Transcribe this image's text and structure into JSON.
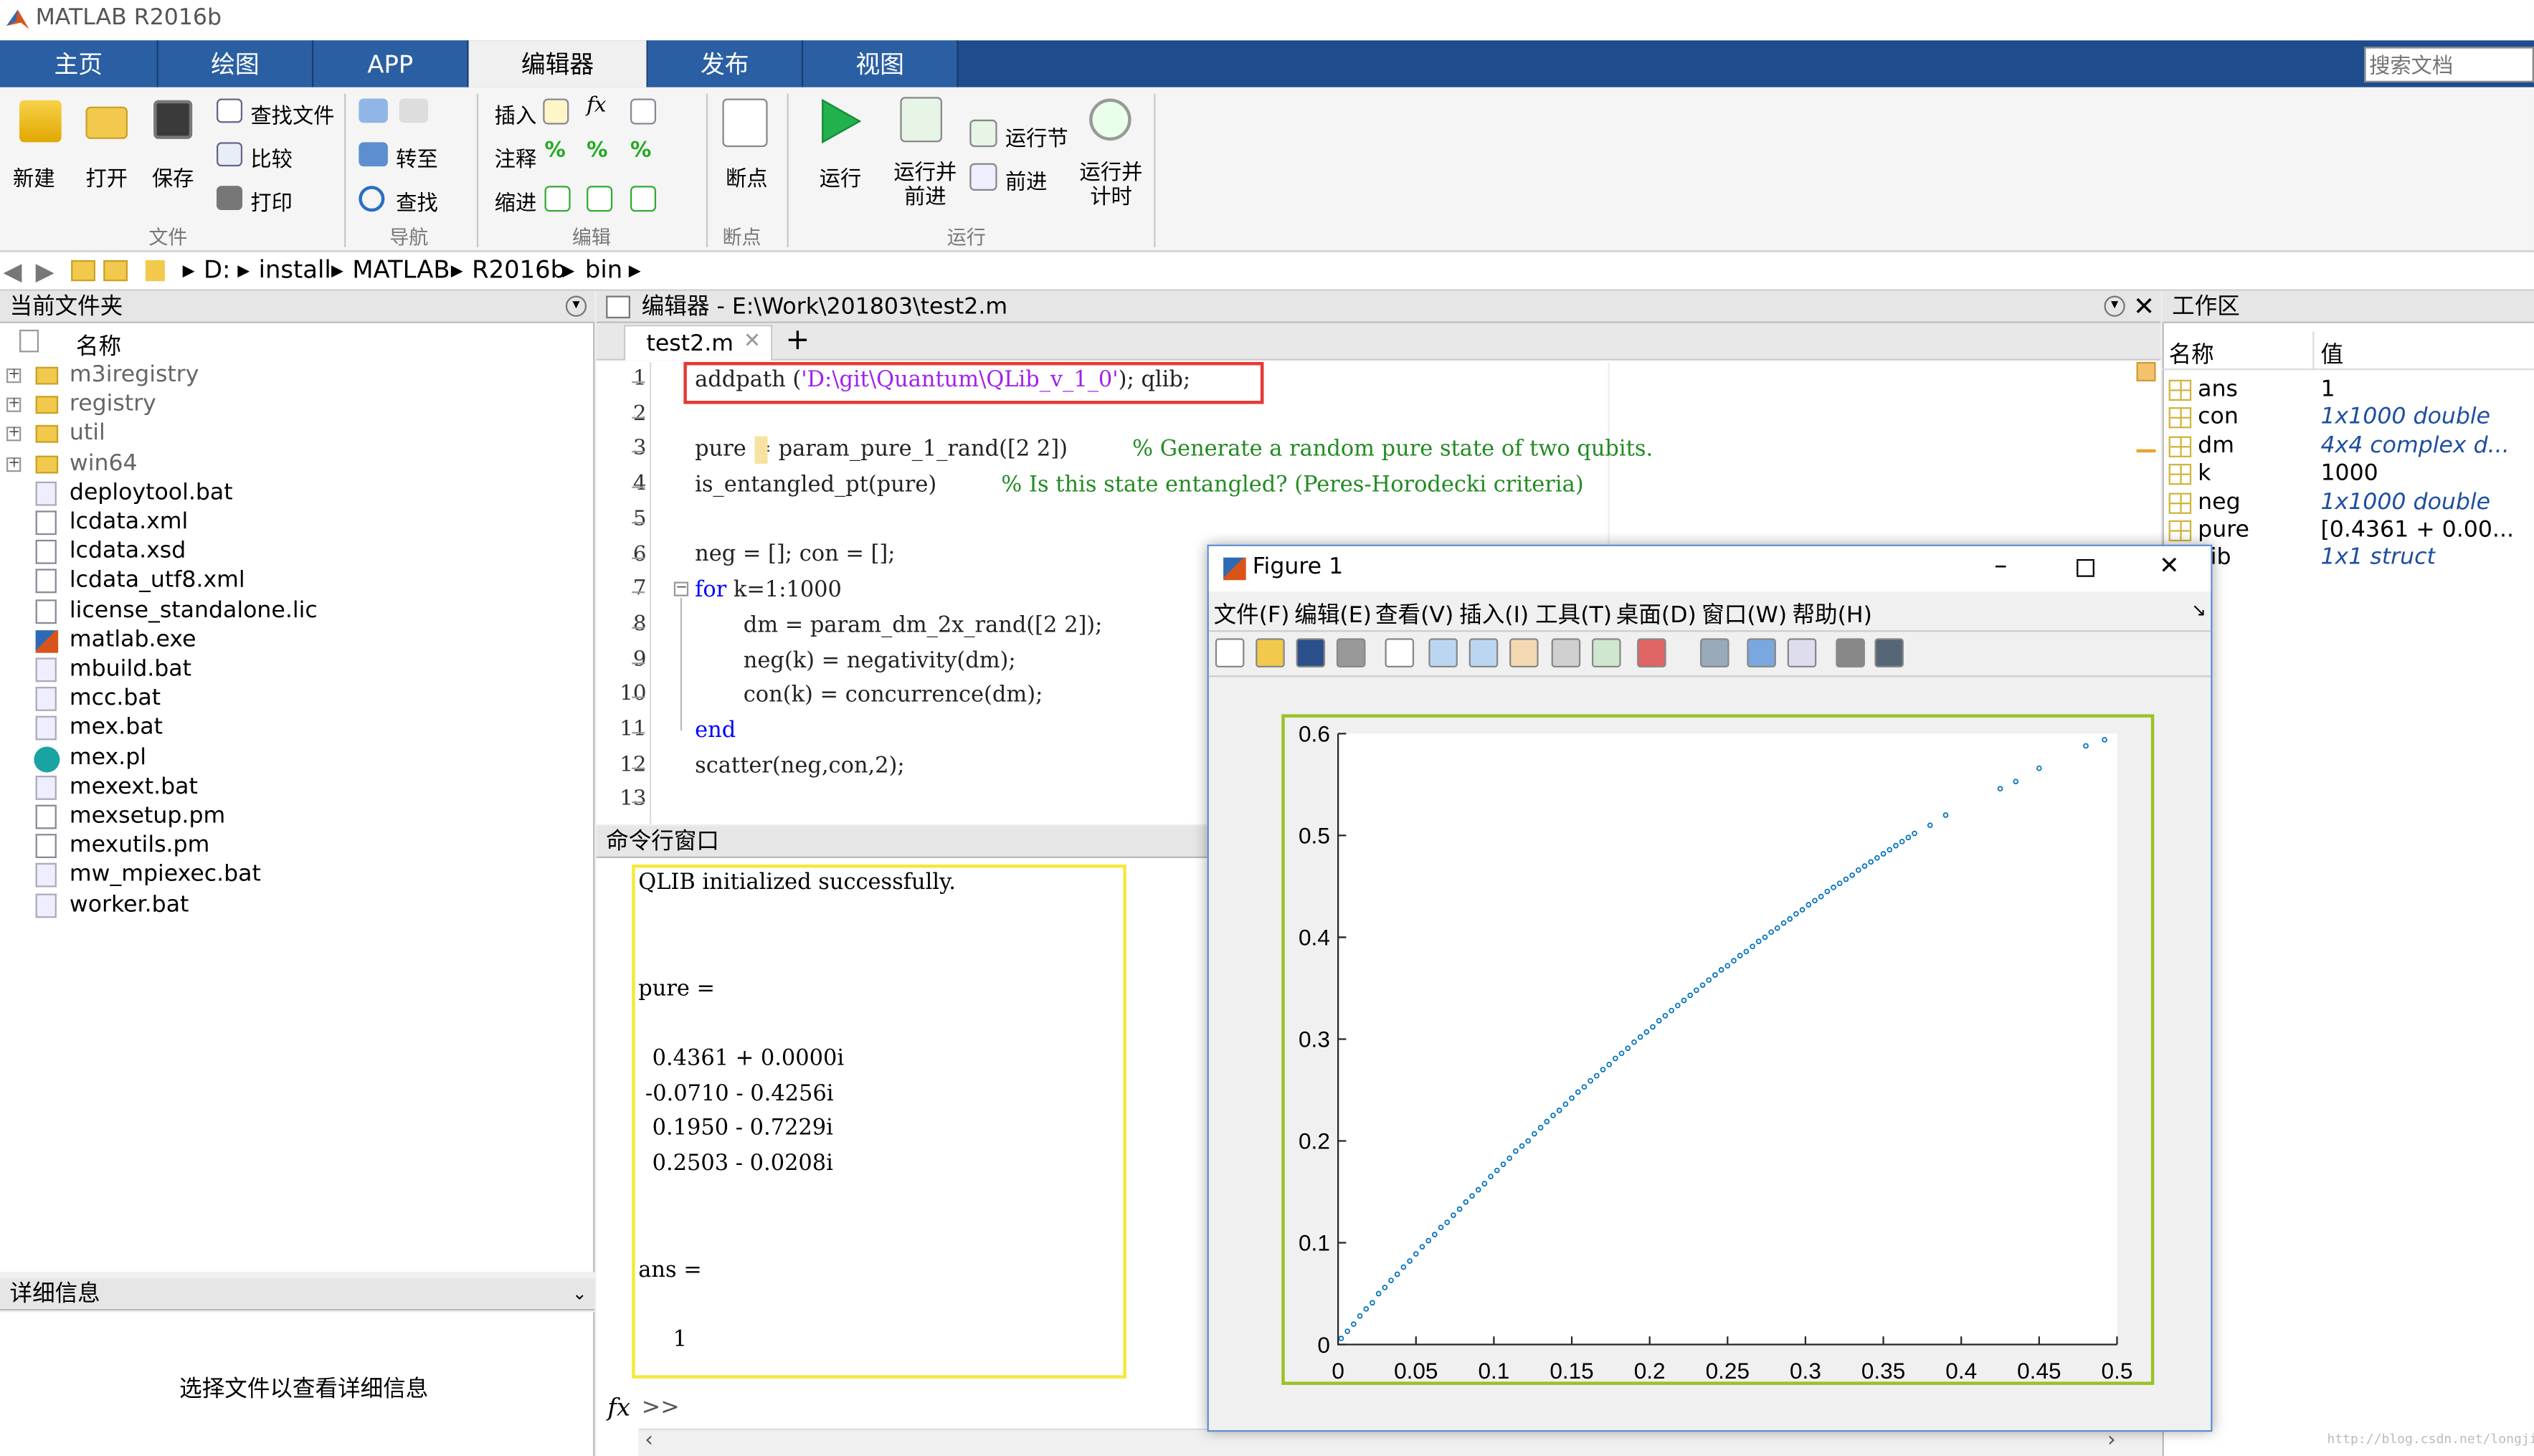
{
  "app": {
    "title": "MATLAB R2016b"
  },
  "menu_tabs": [
    "主页",
    "绘图",
    "APP",
    "编辑器",
    "发布",
    "视图"
  ],
  "search": {
    "placeholder": "搜索文档"
  },
  "ribbon": {
    "file": {
      "new": "新建",
      "open": "打开",
      "save": "保存",
      "find_files": "查找文件",
      "compare": "比较",
      "print": "打印",
      "group": "文件"
    },
    "nav": {
      "goto": "转至",
      "find": "查找",
      "group": "导航"
    },
    "edit": {
      "insert": "插入",
      "comment": "注释",
      "indent": "缩进",
      "group": "编辑"
    },
    "breakpoints": {
      "label": "断点",
      "group": "断点"
    },
    "run": {
      "run": "运行",
      "run_advance": "运行并\n前进",
      "run_section": "运行节",
      "advance": "前进",
      "run_time": "运行并\n计时",
      "group": "运行"
    }
  },
  "path": [
    "D:",
    "install",
    "MATLAB",
    "R2016b",
    "bin"
  ],
  "current_folder": {
    "title": "当前文件夹",
    "header": "名称",
    "items": [
      {
        "name": "m3iregistry",
        "type": "folder"
      },
      {
        "name": "registry",
        "type": "folder"
      },
      {
        "name": "util",
        "type": "folder"
      },
      {
        "name": "win64",
        "type": "folder"
      },
      {
        "name": "deploytool.bat",
        "type": "bat"
      },
      {
        "name": "lcdata.xml",
        "type": "file"
      },
      {
        "name": "lcdata.xsd",
        "type": "file"
      },
      {
        "name": "lcdata_utf8.xml",
        "type": "file"
      },
      {
        "name": "license_standalone.lic",
        "type": "file"
      },
      {
        "name": "matlab.exe",
        "type": "exe"
      },
      {
        "name": "mbuild.bat",
        "type": "bat"
      },
      {
        "name": "mcc.bat",
        "type": "bat"
      },
      {
        "name": "mex.bat",
        "type": "bat"
      },
      {
        "name": "mex.pl",
        "type": "pl"
      },
      {
        "name": "mexext.bat",
        "type": "bat"
      },
      {
        "name": "mexsetup.pm",
        "type": "file"
      },
      {
        "name": "mexutils.pm",
        "type": "file"
      },
      {
        "name": "mw_mpiexec.bat",
        "type": "bat"
      },
      {
        "name": "worker.bat",
        "type": "bat"
      }
    ]
  },
  "details": {
    "title": "详细信息",
    "message": "选择文件以查看详细信息"
  },
  "editor": {
    "title": "编辑器 - E:\\Work\\201803\\test2.m",
    "tab": "test2.m"
  },
  "code_lines": [
    "1",
    "2",
    "3",
    "4",
    "5",
    "6",
    "7",
    "8",
    "9",
    "10",
    "11",
    "12",
    "13"
  ],
  "code": {
    "l1a": "addpath (",
    "l1s": "'D:\\git\\Quantum\\QLib_v_1_0'",
    "l1b": "); qlib;",
    "l3": "pure = param_pure_1_rand([2 2])",
    "l3c": "% Generate a random pure state of two qubits.",
    "l4": "is_entangled_pt(pure)",
    "l4c": "% Is this state entangled? (Peres-Horodecki criteria)",
    "l6": "neg = []; con = [];",
    "l7k": "for",
    "l7": " k=1:1000",
    "l8": "dm = param_dm_2x_rand([2 2]);",
    "l9": "neg(k) = negativity(dm);",
    "l10": "con(k) = concurrence(dm);",
    "l11": "end",
    "l12": "scatter(neg,con,2);"
  },
  "command": {
    "title": "命令行窗口",
    "lines": [
      "QLIB initialized successfully.",
      "pure =",
      "  0.4361 + 0.0000i",
      " -0.0710 - 0.4256i",
      "  0.1950 - 0.7229i",
      "  0.2503 - 0.0208i",
      "ans =",
      "     1"
    ],
    "prompt": ">>"
  },
  "workspace": {
    "title": "工作区",
    "headers": [
      "名称",
      "值"
    ],
    "vars": [
      {
        "name": "ans",
        "value": "1"
      },
      {
        "name": "con",
        "value": "1x1000 double"
      },
      {
        "name": "dm",
        "value": "4x4 complex d..."
      },
      {
        "name": "k",
        "value": "1000"
      },
      {
        "name": "neg",
        "value": "1x1000 double"
      },
      {
        "name": "pure",
        "value": "[0.4361 + 0.00..."
      },
      {
        "name": "Lib",
        "value": "1x1 struct"
      }
    ]
  },
  "figure": {
    "title": "Figure 1",
    "menus": [
      "文件(F)",
      "编辑(E)",
      "查看(V)",
      "插入(I)",
      "工具(T)",
      "桌面(D)",
      "窗口(W)",
      "帮助(H)"
    ]
  },
  "chart_data": {
    "type": "scatter",
    "title": "",
    "xlabel": "",
    "ylabel": "",
    "xlim": [
      0,
      0.5
    ],
    "ylim": [
      0,
      0.6
    ],
    "xticks": [
      "0",
      "0.05",
      "0.1",
      "0.15",
      "0.2",
      "0.25",
      "0.3",
      "0.35",
      "0.4",
      "0.45",
      "0.5"
    ],
    "yticks": [
      "0",
      "0.1",
      "0.2",
      "0.3",
      "0.4",
      "0.5",
      "0.6"
    ],
    "color": "#0072bd",
    "series": [
      {
        "x": [
          0.002,
          0.006,
          0.01,
          0.014,
          0.018,
          0.022,
          0.026,
          0.03,
          0.034,
          0.038,
          0.042,
          0.046,
          0.05,
          0.054,
          0.058,
          0.062,
          0.066,
          0.07,
          0.074,
          0.078,
          0.082,
          0.086,
          0.09,
          0.094,
          0.098,
          0.102,
          0.106,
          0.11,
          0.114,
          0.118,
          0.122,
          0.126,
          0.13,
          0.134,
          0.138,
          0.142,
          0.146,
          0.15,
          0.154,
          0.158,
          0.162,
          0.166,
          0.17,
          0.174,
          0.178,
          0.182,
          0.186,
          0.19,
          0.194,
          0.198,
          0.202,
          0.206,
          0.21,
          0.214,
          0.218,
          0.222,
          0.226,
          0.23,
          0.234,
          0.238,
          0.242,
          0.246,
          0.25,
          0.254,
          0.258,
          0.262,
          0.266,
          0.27,
          0.274,
          0.278,
          0.282,
          0.286,
          0.29,
          0.294,
          0.298,
          0.302,
          0.306,
          0.31,
          0.314,
          0.318,
          0.322,
          0.326,
          0.33,
          0.334,
          0.338,
          0.342,
          0.346,
          0.35,
          0.354,
          0.358,
          0.362,
          0.366,
          0.37,
          0.38,
          0.39,
          0.425,
          0.435,
          0.45,
          0.48,
          0.492
        ],
        "y": [
          0.006,
          0.013,
          0.02,
          0.028,
          0.035,
          0.041,
          0.05,
          0.056,
          0.063,
          0.069,
          0.076,
          0.082,
          0.089,
          0.096,
          0.102,
          0.108,
          0.115,
          0.12,
          0.127,
          0.133,
          0.14,
          0.146,
          0.152,
          0.158,
          0.165,
          0.171,
          0.177,
          0.183,
          0.19,
          0.195,
          0.2,
          0.207,
          0.213,
          0.219,
          0.225,
          0.23,
          0.236,
          0.242,
          0.248,
          0.253,
          0.259,
          0.264,
          0.27,
          0.275,
          0.281,
          0.286,
          0.291,
          0.297,
          0.302,
          0.307,
          0.312,
          0.318,
          0.323,
          0.328,
          0.333,
          0.338,
          0.343,
          0.348,
          0.353,
          0.358,
          0.363,
          0.368,
          0.372,
          0.377,
          0.382,
          0.386,
          0.391,
          0.396,
          0.4,
          0.405,
          0.409,
          0.414,
          0.418,
          0.423,
          0.427,
          0.432,
          0.436,
          0.44,
          0.445,
          0.449,
          0.453,
          0.457,
          0.461,
          0.466,
          0.47,
          0.474,
          0.478,
          0.482,
          0.486,
          0.49,
          0.494,
          0.498,
          0.502,
          0.51,
          0.52,
          0.546,
          0.553,
          0.566,
          0.588,
          0.594
        ]
      }
    ]
  }
}
